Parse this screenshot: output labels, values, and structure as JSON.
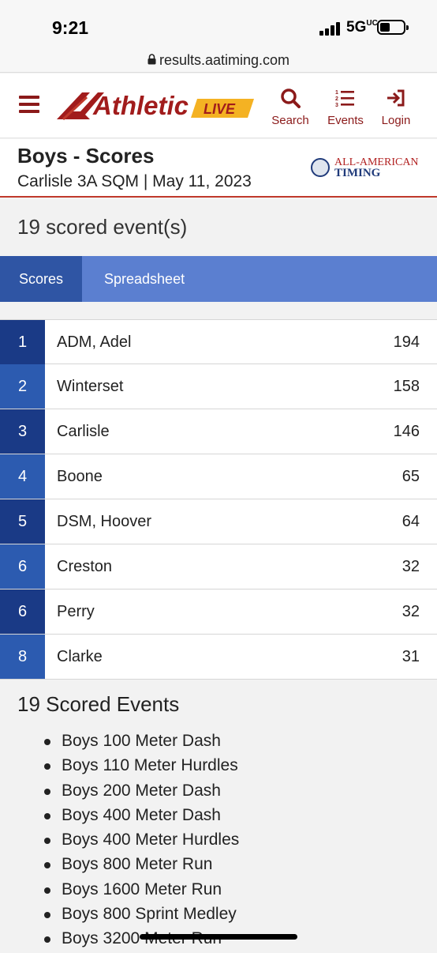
{
  "status_bar": {
    "time": "9:21",
    "network": "5G",
    "network_suffix": "UC"
  },
  "browser": {
    "url": "results.aatiming.com"
  },
  "header": {
    "logo_text": "Athletic",
    "logo_badge": "LIVE",
    "nav": [
      {
        "label": "Search",
        "icon": "search-icon"
      },
      {
        "label": "Events",
        "icon": "list-icon"
      },
      {
        "label": "Login",
        "icon": "login-icon"
      }
    ],
    "accent_color": "#8b1a1a"
  },
  "page": {
    "title": "Boys - Scores",
    "meet_info": "Carlisle 3A SQM | May 11, 2023",
    "timing_logo_top": "ALL-AMERICAN",
    "timing_logo_bottom": "TIMING",
    "scored_count_label": "19 scored event(s)"
  },
  "tabs": [
    {
      "label": "Scores",
      "active": true
    },
    {
      "label": "Spreadsheet",
      "active": false
    }
  ],
  "standings": [
    {
      "rank": "1",
      "team": "ADM, Adel",
      "points": "194",
      "color": "#1a3a86"
    },
    {
      "rank": "2",
      "team": "Winterset",
      "points": "158",
      "color": "#2c5bb0"
    },
    {
      "rank": "3",
      "team": "Carlisle",
      "points": "146",
      "color": "#1a3a86"
    },
    {
      "rank": "4",
      "team": "Boone",
      "points": "65",
      "color": "#2c5bb0"
    },
    {
      "rank": "5",
      "team": "DSM, Hoover",
      "points": "64",
      "color": "#1a3a86"
    },
    {
      "rank": "6",
      "team": "Creston",
      "points": "32",
      "color": "#2c5bb0"
    },
    {
      "rank": "6",
      "team": "Perry",
      "points": "32",
      "color": "#1a3a86"
    },
    {
      "rank": "8",
      "team": "Clarke",
      "points": "31",
      "color": "#2c5bb0"
    }
  ],
  "events_section": {
    "title": "19 Scored Events",
    "events": [
      "Boys 100 Meter Dash",
      "Boys 110 Meter Hurdles",
      "Boys 200 Meter Dash",
      "Boys 400 Meter Dash",
      "Boys 400 Meter Hurdles",
      "Boys 800 Meter Run",
      "Boys 1600 Meter Run",
      "Boys 800 Sprint Medley",
      "Boys 3200 Meter Run"
    ]
  }
}
